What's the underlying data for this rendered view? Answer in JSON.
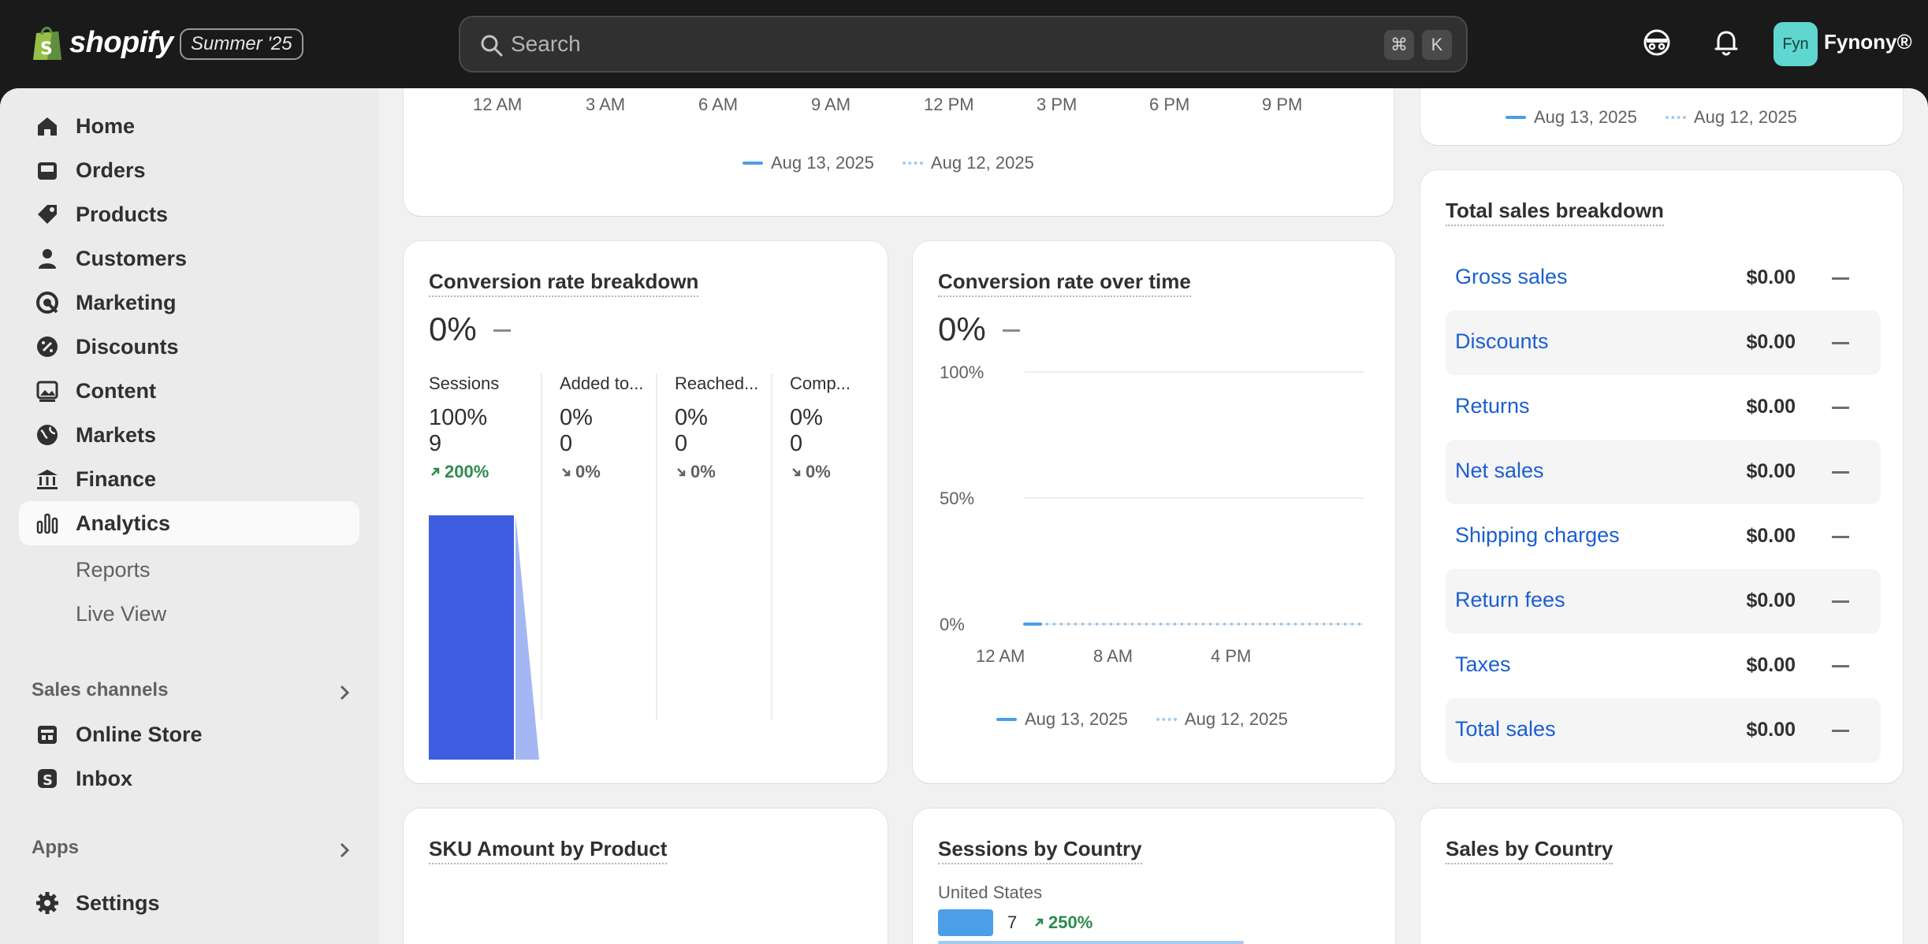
{
  "topbar": {
    "brand": "shopify",
    "edition_badge": "Summer '25",
    "search_placeholder": "Search",
    "shortcut_cmd": "⌘",
    "shortcut_key": "K",
    "avatar_initials": "Fyn",
    "store_name": "Fynony®"
  },
  "sidebar": {
    "items": [
      {
        "label": "Home",
        "icon": "home-icon"
      },
      {
        "label": "Orders",
        "icon": "inbox-tray-icon"
      },
      {
        "label": "Products",
        "icon": "tag-icon"
      },
      {
        "label": "Customers",
        "icon": "person-icon"
      },
      {
        "label": "Marketing",
        "icon": "target-icon"
      },
      {
        "label": "Discounts",
        "icon": "discount-icon"
      },
      {
        "label": "Content",
        "icon": "image-icon"
      },
      {
        "label": "Markets",
        "icon": "globe-icon"
      },
      {
        "label": "Finance",
        "icon": "bank-icon"
      },
      {
        "label": "Analytics",
        "icon": "bar-chart-icon",
        "active": true
      }
    ],
    "sub_items": [
      "Reports",
      "Live View"
    ],
    "sales_channels_label": "Sales channels",
    "channels": [
      {
        "label": "Online Store",
        "icon": "store-icon"
      },
      {
        "label": "Inbox",
        "icon": "shopify-inbox-icon"
      }
    ],
    "apps_label": "Apps",
    "settings_label": "Settings"
  },
  "top_chart": {
    "x_ticks": [
      "12 AM",
      "3 AM",
      "6 AM",
      "9 AM",
      "12 PM",
      "3 PM",
      "6 PM",
      "9 PM"
    ],
    "legend_current": "Aug 13, 2025",
    "legend_previous": "Aug 12, 2025"
  },
  "right_top_legend": {
    "current": "Aug 13, 2025",
    "previous": "Aug 12, 2025"
  },
  "conversion_breakdown": {
    "title": "Conversion rate breakdown",
    "value": "0%",
    "steps": [
      {
        "name": "Sessions",
        "pct": "100%",
        "count": "9",
        "change": "200%",
        "direction": "up"
      },
      {
        "name": "Added to...",
        "pct": "0%",
        "count": "0",
        "change": "0%",
        "direction": "down"
      },
      {
        "name": "Reached...",
        "pct": "0%",
        "count": "0",
        "change": "0%",
        "direction": "down"
      },
      {
        "name": "Comp...",
        "pct": "0%",
        "count": "0",
        "change": "0%",
        "direction": "down"
      }
    ],
    "bar_color": "#3d5ee0",
    "bar_fill_fraction": 1.0
  },
  "conversion_over_time": {
    "title": "Conversion rate over time",
    "value": "0%",
    "y_ticks": [
      "100%",
      "50%",
      "0%"
    ],
    "x_ticks": [
      "12 AM",
      "8 AM",
      "4 PM"
    ],
    "legend_current": "Aug 13, 2025",
    "legend_previous": "Aug 12, 2025"
  },
  "chart_data": {
    "type": "line",
    "title": "Conversion rate over time",
    "x": [
      "12 AM",
      "8 AM",
      "4 PM"
    ],
    "ylim": [
      0,
      100
    ],
    "series": [
      {
        "name": "Aug 13, 2025",
        "values": [
          0
        ]
      },
      {
        "name": "Aug 12, 2025",
        "values": [
          0,
          0,
          0
        ]
      }
    ],
    "grid": true,
    "legend": "bottom"
  },
  "sales_breakdown": {
    "title": "Total sales breakdown",
    "rows": [
      {
        "label": "Gross sales",
        "value": "$0.00"
      },
      {
        "label": "Discounts",
        "value": "$0.00"
      },
      {
        "label": "Returns",
        "value": "$0.00"
      },
      {
        "label": "Net sales",
        "value": "$0.00"
      },
      {
        "label": "Shipping charges",
        "value": "$0.00"
      },
      {
        "label": "Return fees",
        "value": "$0.00"
      },
      {
        "label": "Taxes",
        "value": "$0.00"
      },
      {
        "label": "Total sales",
        "value": "$0.00"
      }
    ]
  },
  "sku_card": {
    "title": "SKU Amount by Product"
  },
  "sessions_country": {
    "title": "Sessions by Country",
    "rows": [
      {
        "country": "United States",
        "value": "7",
        "change": "250%"
      }
    ]
  },
  "sales_country": {
    "title": "Sales by Country"
  }
}
